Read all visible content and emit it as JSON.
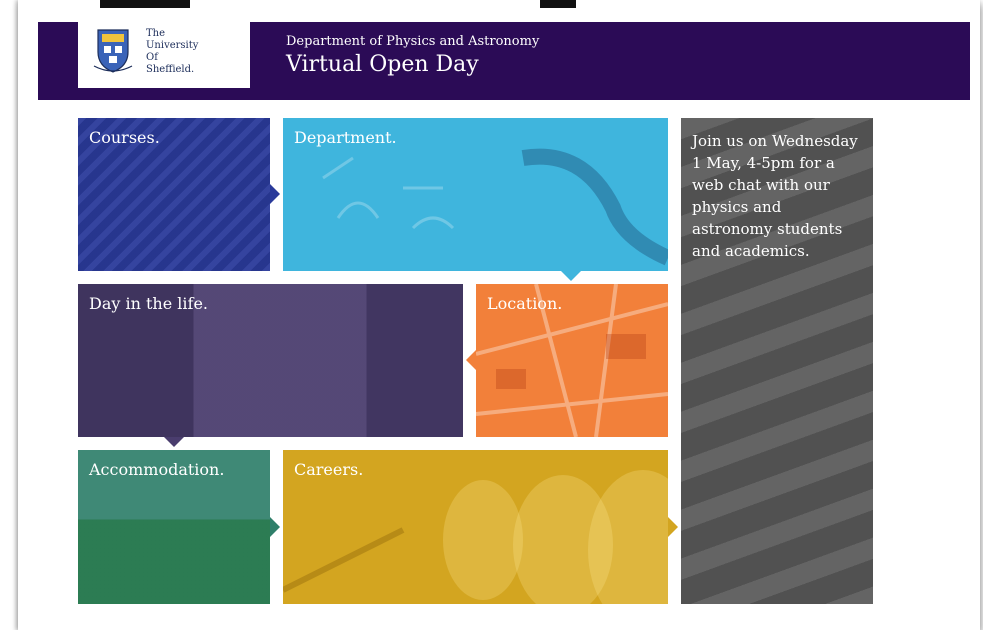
{
  "header": {
    "logo_lines": [
      "The",
      "University",
      "Of",
      "Sheffield."
    ],
    "department": "Department of Physics and Astronomy",
    "title": "Virtual Open Day"
  },
  "tiles": {
    "courses": "Courses.",
    "department": "Department.",
    "day_in_life": "Day in the life.",
    "location": "Location.",
    "accommodation": "Accommodation.",
    "careers": "Careers."
  },
  "promo": {
    "text": "Join us on Wednesday 1 May, 4-5pm for a web chat with our physics and astronomy students and academics."
  },
  "colors": {
    "header_bg": "#2b0b56",
    "courses": "#2a3a9a",
    "department": "#3fb5dd",
    "day_in_life": "#4a3d6e",
    "location": "#f2803a",
    "accommodation": "#2f7f6a",
    "careers": "#d3a520",
    "promo": "#5a5a5a"
  }
}
